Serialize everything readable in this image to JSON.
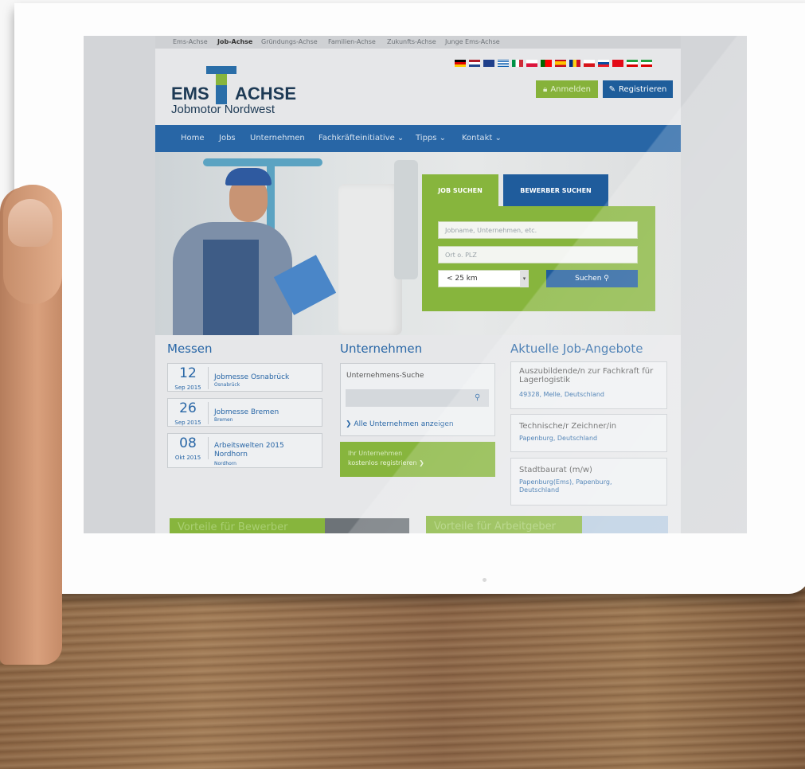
{
  "topnav": [
    "Ems-Achse",
    "Job-Achse",
    "Gründungs-Achse",
    "Familien-Achse",
    "Zukunfts-Achse",
    "Junge Ems-Achse"
  ],
  "logo": {
    "left": "EMS",
    "right": "ACHSE",
    "sub": "Jobmotor Nordwest"
  },
  "auth": {
    "login": "Anmelden",
    "register": "Registrieren"
  },
  "mainnav": [
    "Home",
    "Jobs",
    "Unternehmen",
    "Fachkräfteinitiative ⌄",
    "Tipps ⌄",
    "Kontakt ⌄"
  ],
  "search": {
    "tab_job": "JOB SUCHEN",
    "tab_bewerber": "BEWERBER SUCHEN",
    "placeholder_job": "Jobname, Unternehmen, etc.",
    "placeholder_ort": "Ort o. PLZ",
    "radius": "< 25 km",
    "button": "Suchen"
  },
  "messen": {
    "title": "Messen",
    "events": [
      {
        "day": "12",
        "month": "Sep 2015",
        "name": "Jobmesse Osnabrück",
        "city": "Osnabrück"
      },
      {
        "day": "26",
        "month": "Sep 2015",
        "name": "Jobmesse Bremen",
        "city": "Bremen"
      },
      {
        "day": "08",
        "month": "Okt 2015",
        "name": "Arbeitswelten 2015 Nordhorn",
        "city": "Nordhorn"
      }
    ]
  },
  "unternehmen": {
    "title": "Unternehmen",
    "search_label": "Unternehmens-Suche",
    "all_link": "Alle Unternehmen anzeigen",
    "register_line1": "Ihr Unternehmen",
    "register_line2": "kostenlos registrieren"
  },
  "jobs": {
    "title": "Aktuelle Job-Angebote",
    "items": [
      {
        "title": "Auszubildende/n zur Fachkraft für Lagerlogistik",
        "location": "49328, Melle, Deutschland"
      },
      {
        "title": "Technische/r Zeichner/in",
        "location": "Papenburg, Deutschland"
      },
      {
        "title": "Stadtbaurat (m/w)",
        "location": "Papenburg(Ems), Papenburg, Deutschland"
      }
    ]
  },
  "bottom": {
    "left": "Vorteile für Bewerber",
    "right": "Vorteile für Arbeitgeber"
  },
  "colors": {
    "blue": "#2866a6",
    "green": "#87b53d",
    "dark_blue": "#1f5c9c"
  }
}
